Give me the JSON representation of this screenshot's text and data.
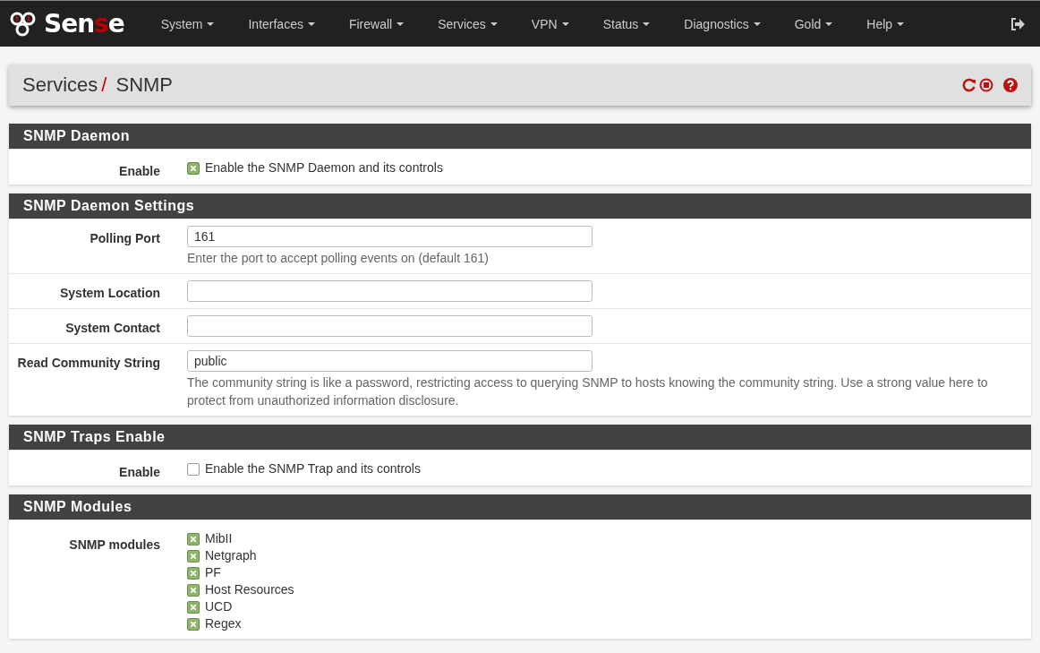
{
  "logo": {
    "parts": [
      "Sen",
      "s",
      "e"
    ]
  },
  "menu": [
    "System",
    "Interfaces",
    "Firewall",
    "Services",
    "VPN",
    "Status",
    "Diagnostics",
    "Gold",
    "Help"
  ],
  "breadcrumb": {
    "parent": "Services",
    "separator": "/",
    "current": "SNMP"
  },
  "sections": [
    {
      "title": "SNMP Daemon",
      "rows": [
        {
          "kind": "checkbox",
          "label": "Enable",
          "text": "Enable the SNMP Daemon and its controls",
          "checked": true
        }
      ]
    },
    {
      "title": "SNMP Daemon Settings",
      "rows": [
        {
          "kind": "input",
          "label": "Polling Port",
          "value": "161",
          "help": "Enter the port to accept polling events on (default 161)"
        },
        {
          "kind": "input",
          "label": "System Location"
        },
        {
          "kind": "input",
          "label": "System Contact"
        },
        {
          "kind": "input",
          "label": "Read Community String",
          "value": "public",
          "help": "The community string is like a password, restricting access to querying SNMP to hosts knowing the community string. Use a strong value here to protect from unauthorized information disclosure."
        }
      ]
    },
    {
      "title": "SNMP Traps Enable",
      "rows": [
        {
          "kind": "checkbox",
          "label": "Enable",
          "text": "Enable the SNMP Trap and its controls",
          "checked": false
        }
      ]
    },
    {
      "title": "SNMP Modules",
      "rows": [
        {
          "kind": "checklist",
          "label": "SNMP modules",
          "items": [
            {
              "text": "MibII",
              "checked": true
            },
            {
              "text": "Netgraph",
              "checked": true
            },
            {
              "text": "PF",
              "checked": true
            },
            {
              "text": "Host Resources",
              "checked": true
            },
            {
              "text": "UCD",
              "checked": true
            },
            {
              "text": "Regex",
              "checked": true
            }
          ]
        }
      ]
    }
  ]
}
